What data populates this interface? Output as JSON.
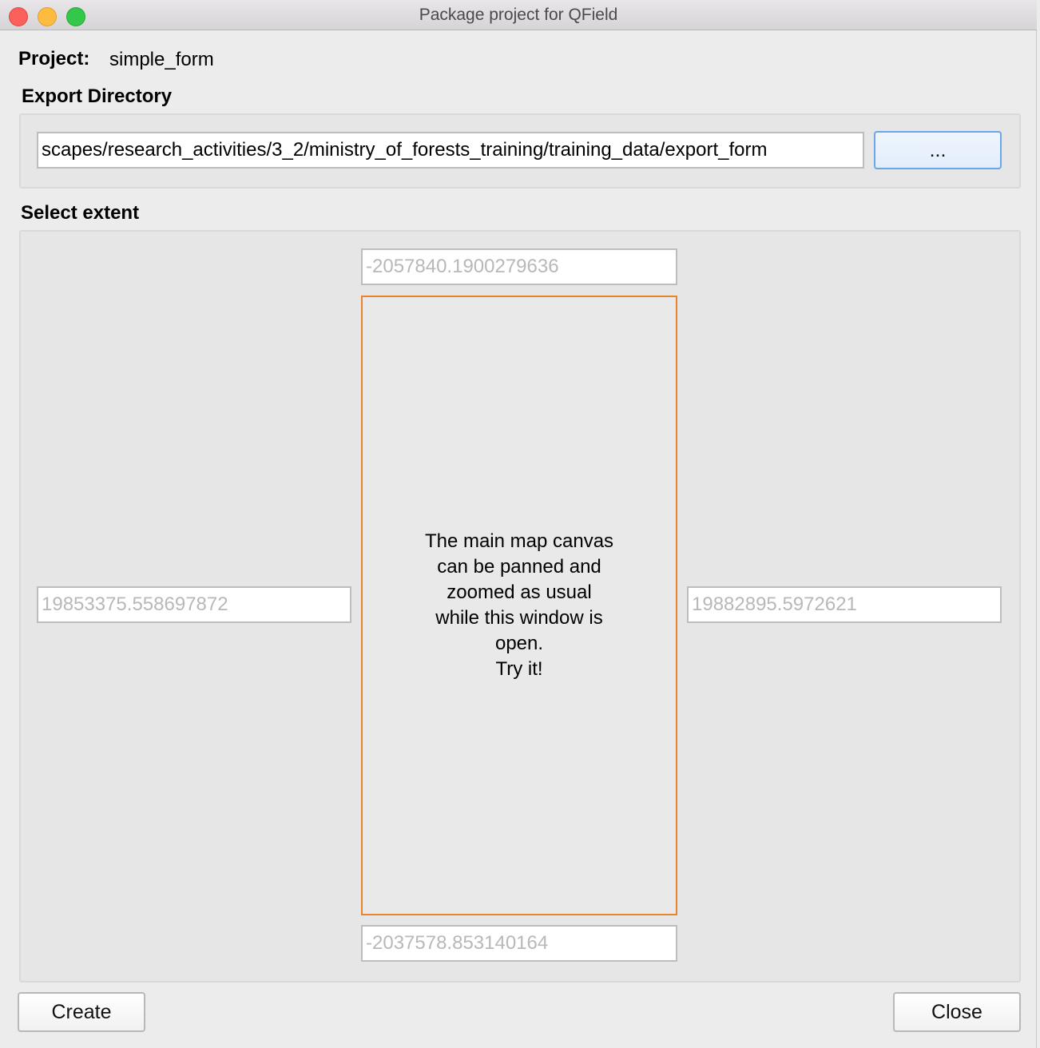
{
  "window": {
    "title": "Package project for QField"
  },
  "project": {
    "label": "Project:",
    "name": "simple_form"
  },
  "export_directory": {
    "heading": "Export Directory",
    "path": "scapes/research_activities/3_2/ministry_of_forests_training/training_data/export_form",
    "browse_label": "..."
  },
  "extent": {
    "heading": "Select extent",
    "north": "-2057840.1900279636",
    "south": "-2037578.853140164",
    "west": "19853375.558697872",
    "east": "19882895.5972621",
    "message_lines": [
      "The main map canvas",
      "can be panned and",
      "zoomed as usual",
      "while this window is",
      "open.",
      "Try it!"
    ]
  },
  "buttons": {
    "create": "Create",
    "close": "Close"
  },
  "colors": {
    "extent_border": "#e8842c",
    "focus_border": "#6aa6ea"
  }
}
